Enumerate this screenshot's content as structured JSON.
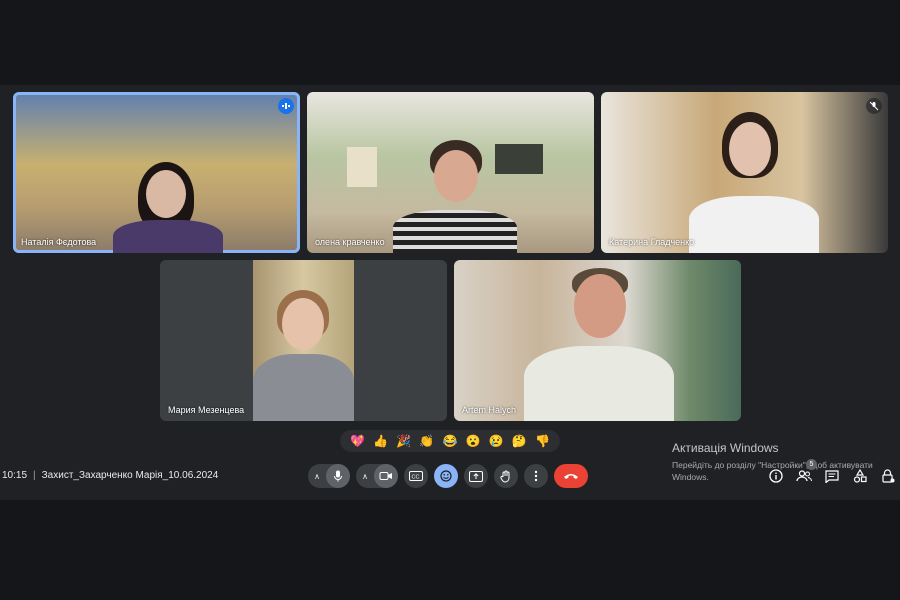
{
  "participants": [
    {
      "name": "Наталія Фєдотова",
      "state": "speaking",
      "colors": {
        "bg": "#c9b98a",
        "shirt": "#4a3a6a",
        "hair": "#1b1412",
        "skin": "#d9b8a4"
      }
    },
    {
      "name": "олена кравченко",
      "state": "none",
      "colors": {
        "bg": "#b9c6a8",
        "shirt": "#2a2a2a",
        "hair": "#3a2a24",
        "skin": "#d8a891"
      }
    },
    {
      "name": "Катерина Гладченко",
      "state": "muted",
      "colors": {
        "bg": "#d7c5a6",
        "shirt": "#f1f1f1",
        "hair": "#2c1f17",
        "skin": "#e2c1ae"
      }
    },
    {
      "name": "Мария Мезенцева",
      "state": "none",
      "colors": {
        "bg": "#c8b68a",
        "shirt": "#8a8d93",
        "hair": "#9b6f4a",
        "skin": "#e6c2ab"
      }
    },
    {
      "name": "Artem Halych",
      "state": "none",
      "colors": {
        "bg": "#d4d0c7",
        "shirt": "#e8eae2",
        "hair": "#5a4a3a",
        "skin": "#d49b84"
      }
    }
  ],
  "reactions": [
    "💖",
    "👍",
    "🎉",
    "👏",
    "😂",
    "😮",
    "😢",
    "🤔",
    "👎"
  ],
  "meeting": {
    "time": "10:15",
    "separator": "|",
    "title": "Захист_Захарченко Марія_10.06.2024"
  },
  "windows_watermark": {
    "title": "Активація Windows",
    "line1": "Перейдіть до розділу \"Настройки\", щоб активувати",
    "line2": "Windows."
  },
  "people_count": "5",
  "icons": {
    "speaking": "audio-level-icon",
    "muted": "mic-off-icon",
    "mic": "mic-icon",
    "camera": "camera-icon",
    "captions": "captions-icon",
    "emoji": "emoji-icon",
    "present": "present-icon",
    "hand": "raise-hand-icon",
    "more": "more-vert-icon",
    "end": "call-end-icon"
  },
  "accent": "#8ab4f8",
  "end_call_color": "#ea4335"
}
